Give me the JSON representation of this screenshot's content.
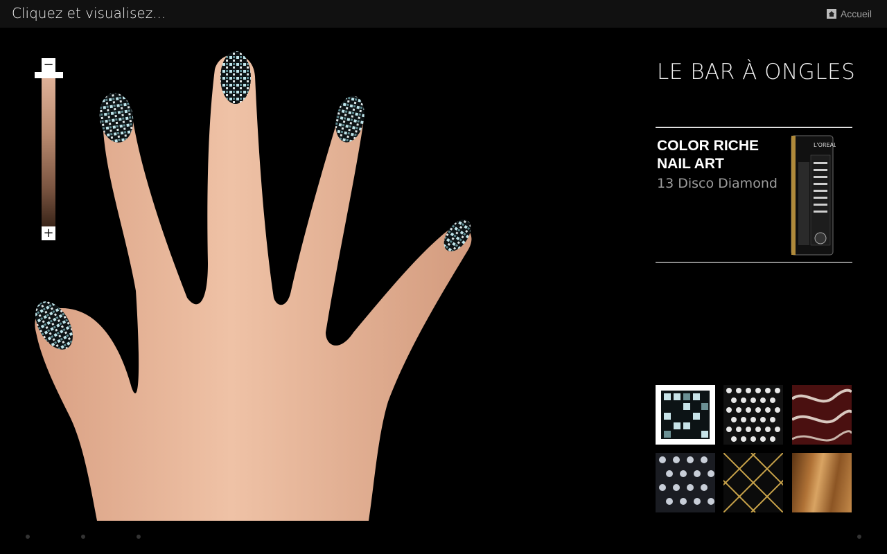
{
  "header": {
    "title": "Cliquez et visualisez...",
    "home_label": "Accueil",
    "home_icon": "home-icon"
  },
  "zoom": {
    "minus_label": "−",
    "plus_label": "+"
  },
  "panel": {
    "brand_title": "LE BAR À ONGLES",
    "product_name": "COLOR RICHE NAIL ART",
    "shade": "13 Disco Diamond",
    "bottle_brand": "L'OREAL"
  },
  "swatches": [
    {
      "name": "disco-diamond-swatch",
      "selected": true
    },
    {
      "name": "silver-studs-swatch",
      "selected": false
    },
    {
      "name": "red-snake-swatch",
      "selected": false
    },
    {
      "name": "silver-dots-swatch",
      "selected": false
    },
    {
      "name": "gold-lattice-swatch",
      "selected": false
    },
    {
      "name": "bronze-foil-swatch",
      "selected": false
    }
  ],
  "colors": {
    "background": "#000000",
    "topbar": "#111111",
    "skin": "#e8b79a"
  }
}
